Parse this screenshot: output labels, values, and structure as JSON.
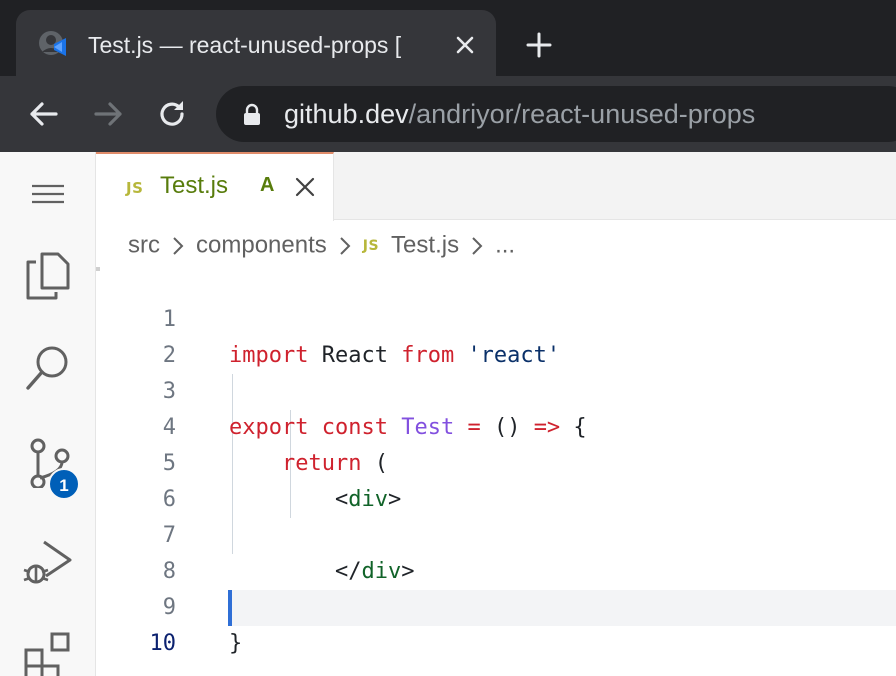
{
  "browser": {
    "tab_title": "Test.js — react-unused-props [",
    "url_host": "github.dev",
    "url_path": "/andriyor/react-unused-props"
  },
  "activity_bar": {
    "items": [
      "menu-icon",
      "explorer-icon",
      "search-icon",
      "source-control-icon",
      "run-debug-icon",
      "extensions-icon"
    ],
    "source_control_badge": "1"
  },
  "editor_tab": {
    "icon_text": "JS",
    "filename": "Test.js",
    "status": "A"
  },
  "breadcrumb": {
    "items": [
      "src",
      "components",
      "Test.js",
      "..."
    ],
    "file_icon": "JS"
  },
  "code": {
    "line_numbers": [
      "1",
      "2",
      "3",
      "4",
      "5",
      "6",
      "7",
      "8",
      "9",
      "10"
    ],
    "lines": [
      {
        "tokens": [
          "import",
          " React ",
          "from",
          " ",
          "'react'"
        ]
      },
      {
        "tokens": []
      },
      {
        "tokens": [
          "export",
          " ",
          "const",
          " ",
          "Test",
          " ",
          "=",
          " () ",
          "=>",
          " {"
        ]
      },
      {
        "tokens": [
          "    ",
          "return",
          " ("
        ]
      },
      {
        "tokens": [
          "        <",
          "div",
          ">"
        ]
      },
      {
        "tokens": []
      },
      {
        "tokens": [
          "        </",
          "div",
          ">"
        ]
      },
      {
        "tokens": [
          "    )"
        ]
      },
      {
        "tokens": [
          "}"
        ]
      },
      {
        "tokens": []
      }
    ]
  },
  "colors": {
    "keyword": "#cf222e",
    "function": "#8250df",
    "string": "#0a3069",
    "tag": "#116329",
    "modified": "#587c0c",
    "accent": "#005fb8"
  }
}
